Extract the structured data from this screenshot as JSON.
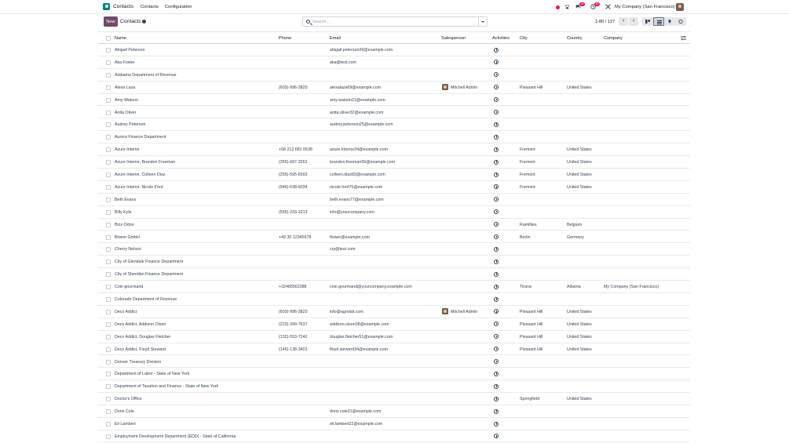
{
  "app": {
    "name": "Contacts",
    "icon": "contacts-app-icon",
    "color": "#017e84"
  },
  "menu": {
    "contacts": "Contacts",
    "configuration": "Configuration"
  },
  "systray": {
    "messages_count": "14",
    "activity_count": "32",
    "company": "My Company (San Francisco)"
  },
  "control": {
    "new_label": "New",
    "breadcrumb": "Contacts",
    "search_placeholder": "Search...",
    "pager": "1-80 / 127",
    "views": [
      "kanban",
      "list",
      "map",
      "activity"
    ],
    "active_view": "list"
  },
  "columns": {
    "name": "Name",
    "phone": "Phone",
    "email": "Email",
    "salesperson": "Salesperson",
    "activities": "Activities",
    "city": "City",
    "country": "Country",
    "company": "Company"
  },
  "rows": [
    {
      "name": "Abigail Peterson",
      "phone": "",
      "email": "abigail.peterson39@example.com",
      "salesperson": "",
      "city": "",
      "country": "",
      "company": ""
    },
    {
      "name": "Aka Foster",
      "phone": "",
      "email": "aka@test.com",
      "salesperson": "",
      "city": "",
      "country": "",
      "company": ""
    },
    {
      "name": "Alabama Department of Revenue",
      "phone": "",
      "email": "",
      "salesperson": "",
      "city": "",
      "country": "",
      "company": ""
    },
    {
      "name": "Alexa Laza",
      "phone": "(603)-996-3829",
      "email": "alexalaza69@example.com",
      "salesperson": "Mitchell Admin",
      "city": "Pleasant Hill",
      "country": "United States",
      "company": ""
    },
    {
      "name": "Amy Watson",
      "phone": "",
      "email": "amy.watson21@example.com",
      "salesperson": "",
      "city": "",
      "country": "",
      "company": ""
    },
    {
      "name": "Anita Oliver",
      "phone": "",
      "email": "anita.oliver32@example.com",
      "salesperson": "",
      "city": "",
      "country": "",
      "company": ""
    },
    {
      "name": "Audrey Peterson",
      "phone": "",
      "email": "audrey.peterson25@example.com",
      "salesperson": "",
      "city": "",
      "country": "",
      "company": ""
    },
    {
      "name": "Aurora Finance Department",
      "phone": "",
      "email": "",
      "salesperson": "",
      "city": "",
      "country": "",
      "company": ""
    },
    {
      "name": "Azure Interior",
      "phone": "+58 212 681 0538",
      "email": "azure.Interior24@example.com",
      "salesperson": "",
      "city": "Fremont",
      "country": "United States",
      "company": ""
    },
    {
      "name": "Azure Interior, Brandon Freeman",
      "phone": "(355)-687-3262",
      "email": "brandon.freeman55@example.com",
      "salesperson": "",
      "city": "Fremont",
      "country": "United States",
      "company": ""
    },
    {
      "name": "Azure Interior, Colleen Diaz",
      "phone": "(255)-595-8393",
      "email": "colleen.diaz83@example.com",
      "salesperson": "",
      "city": "Fremont",
      "country": "United States",
      "company": ""
    },
    {
      "name": "Azure Interior, Nicole Ford",
      "phone": "(946)-638-6034",
      "email": "nicole.ford75@example.com",
      "salesperson": "",
      "city": "Fremont",
      "country": "United States",
      "company": ""
    },
    {
      "name": "Beth Evans",
      "phone": "",
      "email": "beth.evans77@example.com",
      "salesperson": "",
      "city": "",
      "country": "",
      "company": ""
    },
    {
      "name": "Billy Kyle",
      "phone": "(555)-233-3213",
      "email": "info@yourcompany.com",
      "salesperson": "",
      "city": "",
      "country": "",
      "company": ""
    },
    {
      "name": "Bizz-Odoo",
      "phone": "",
      "email": "",
      "salesperson": "",
      "city": "Ramillies",
      "country": "Belgium",
      "company": ""
    },
    {
      "name": "Bloem GmbH",
      "phone": "+49 30 12345678",
      "email": "flower@example.com",
      "salesperson": "",
      "city": "Berlin",
      "country": "Germany",
      "company": ""
    },
    {
      "name": "Cherry Nelson",
      "phone": "",
      "email": "cry@test.com",
      "salesperson": "",
      "city": "",
      "country": "",
      "company": ""
    },
    {
      "name": "City of Glendale Finance Department",
      "phone": "",
      "email": "",
      "salesperson": "",
      "city": "",
      "country": "",
      "company": ""
    },
    {
      "name": "City of Sheridan Finance Department",
      "phone": "",
      "email": "",
      "salesperson": "",
      "city": "",
      "country": "",
      "company": ""
    },
    {
      "name": "Coin gourmand",
      "phone": "+32485562388",
      "email": "coin.gourmand@yourcompany.example.com",
      "salesperson": "",
      "city": "Tirana",
      "country": "Albania",
      "company": "My Company (San Francisco)"
    },
    {
      "name": "Colorado Department of Revenue",
      "phone": "",
      "email": "",
      "salesperson": "",
      "city": "",
      "country": "",
      "company": ""
    },
    {
      "name": "Deco Addict",
      "phone": "(603)-996-3829",
      "email": "info@agrolait.com",
      "salesperson": "Mitchell Admin",
      "city": "Pleasant Hill",
      "country": "United States",
      "company": ""
    },
    {
      "name": "Deco Addict, Addison Olson",
      "phone": "(223)-399-7637",
      "email": "addison.olson28@example.com",
      "salesperson": "",
      "city": "Pleasant Hill",
      "country": "United States",
      "company": ""
    },
    {
      "name": "Deco Addict, Douglas Fletcher",
      "phone": "(132)-553-7242",
      "email": "douglas.fletcher51@example.com",
      "salesperson": "",
      "city": "Pleasant Hill",
      "country": "United States",
      "company": ""
    },
    {
      "name": "Deco Addict, Floyd Steward",
      "phone": "(145)-138-3401",
      "email": "floyd.steward34@example.com",
      "salesperson": "",
      "city": "Pleasant Hill",
      "country": "United States",
      "company": ""
    },
    {
      "name": "Denver Treasury Division",
      "phone": "",
      "email": "",
      "salesperson": "",
      "city": "",
      "country": "",
      "company": ""
    },
    {
      "name": "Department of Labor - State of New York",
      "phone": "",
      "email": "",
      "salesperson": "",
      "city": "",
      "country": "",
      "company": ""
    },
    {
      "name": "Department of Taxation and Finance - State of New York",
      "phone": "",
      "email": "",
      "salesperson": "",
      "city": "",
      "country": "",
      "company": ""
    },
    {
      "name": "Doctor's Office",
      "phone": "",
      "email": "",
      "salesperson": "",
      "city": "Springfield",
      "country": "United States",
      "company": ""
    },
    {
      "name": "Doris Cole",
      "phone": "",
      "email": "doris.cole31@example.com",
      "salesperson": "",
      "city": "",
      "country": "",
      "company": ""
    },
    {
      "name": "Eli Lambert",
      "phone": "",
      "email": "eli.lambert22@example.com",
      "salesperson": "",
      "city": "",
      "country": "",
      "company": ""
    },
    {
      "name": "Employment Development Department (EDD) - State of California",
      "phone": "",
      "email": "",
      "salesperson": "",
      "city": "",
      "country": "",
      "company": ""
    }
  ],
  "colors": {
    "brand": "#714b67",
    "accent": "#017e84",
    "badge": "#e11d48"
  }
}
